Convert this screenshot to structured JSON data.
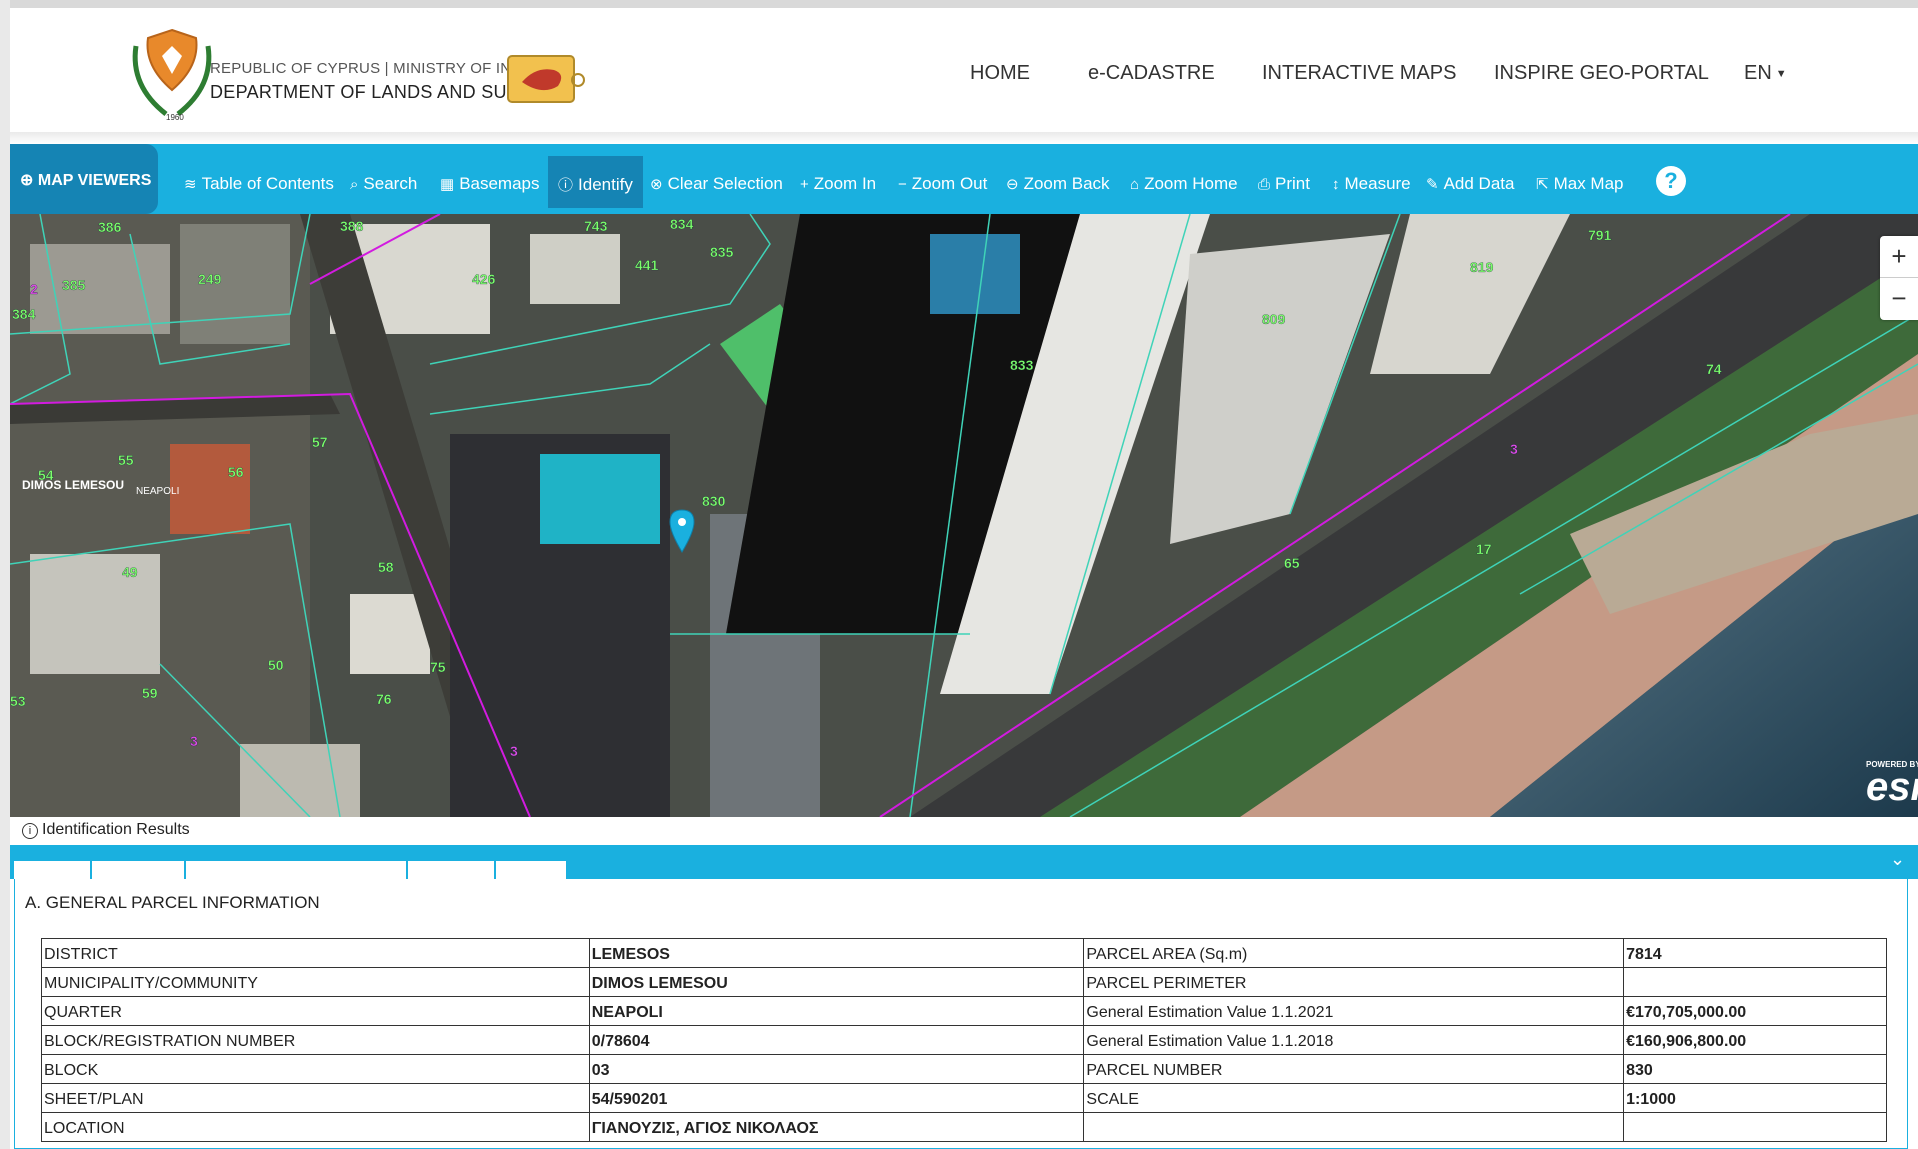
{
  "header": {
    "org_line1": "REPUBLIC OF CYPRUS | MINISTRY OF INTERIOR",
    "org_line2": "DEPARTMENT OF LANDS AND SURVEYS",
    "nav": [
      "HOME",
      "e-CADASTRE",
      "INTERACTIVE MAPS",
      "INSPIRE GEO-PORTAL"
    ],
    "language": "EN"
  },
  "toolbar": {
    "map_viewers": "MAP VIEWERS",
    "tools": [
      {
        "label": "Table of Contents",
        "icon": "layers-icon"
      },
      {
        "label": "Search",
        "icon": "search-icon"
      },
      {
        "label": "Basemaps",
        "icon": "grid-icon"
      },
      {
        "label": "Identify",
        "icon": "info-icon",
        "active": true
      },
      {
        "label": "Clear Selection",
        "icon": "clear-icon"
      },
      {
        "label": "Zoom In",
        "icon": "plus-icon"
      },
      {
        "label": "Zoom Out",
        "icon": "minus-icon"
      },
      {
        "label": "Zoom Back",
        "icon": "back-icon"
      },
      {
        "label": "Zoom Home",
        "icon": "home-icon"
      },
      {
        "label": "Print",
        "icon": "print-icon"
      },
      {
        "label": "Measure",
        "icon": "measure-icon"
      },
      {
        "label": "Add Data",
        "icon": "edit-icon"
      },
      {
        "label": "Max Map",
        "icon": "external-icon"
      }
    ],
    "help": "?"
  },
  "map": {
    "parcel_labels": [
      "386",
      "388",
      "743",
      "834",
      "835",
      "441",
      "426",
      "249",
      "385",
      "384",
      "2",
      "833",
      "809",
      "819",
      "791",
      "74",
      "57",
      "55",
      "56",
      "54",
      "830",
      "49",
      "58",
      "50",
      "75",
      "59",
      "76",
      "53",
      "65",
      "17",
      "3",
      "3",
      "3"
    ],
    "place_label": "DIMOS LEMESOU",
    "place_label2": "NEAPOLI",
    "zoom_in": "+",
    "zoom_out": "−",
    "esri_powered": "POWERED BY",
    "esri": "esri"
  },
  "results": {
    "title": "Identification Results",
    "section": "A. GENERAL PARCEL INFORMATION",
    "rows": [
      [
        "DISTRICT",
        "LEMESOS",
        "PARCEL AREA (Sq.m)",
        "7814"
      ],
      [
        "MUNICIPALITY/COMMUNITY",
        "DIMOS LEMESOU",
        "PARCEL PERIMETER",
        ""
      ],
      [
        "QUARTER",
        "NEAPOLI",
        "General Estimation Value 1.1.2021",
        "€170,705,000.00"
      ],
      [
        "BLOCK/REGISTRATION NUMBER",
        "0/78604",
        "General Estimation Value 1.1.2018",
        "€160,906,800.00"
      ],
      [
        "BLOCK",
        "03",
        "PARCEL NUMBER",
        "830"
      ],
      [
        "SHEET/PLAN",
        "54/590201",
        "SCALE",
        "1:1000"
      ],
      [
        "LOCATION",
        "ΓΙΑΝΟΥΖΙΣ, ΑΓΙΟΣ ΝΙΚΟΛΑΟΣ",
        "",
        ""
      ]
    ]
  },
  "colors": {
    "toolbar": "#1ab0df",
    "toolbar_active": "#1584b4",
    "boundary": "#d21be0",
    "parcel_line": "#3fd3b8"
  }
}
